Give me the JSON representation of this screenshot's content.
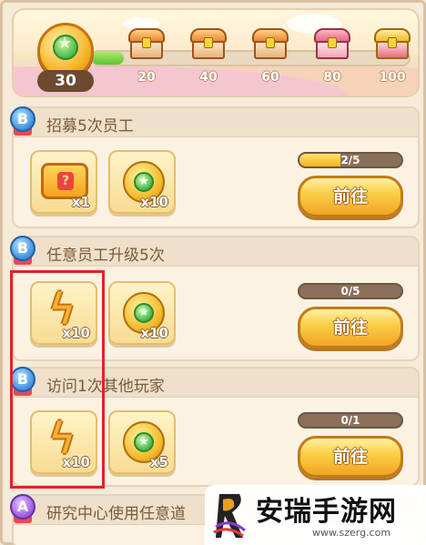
{
  "level": {
    "value": "30"
  },
  "milestones": [
    {
      "label": "20",
      "style": "orange"
    },
    {
      "label": "40",
      "style": "orange"
    },
    {
      "label": "60",
      "style": "orange"
    },
    {
      "label": "80",
      "style": "pink"
    },
    {
      "label": "100",
      "style": "gold"
    }
  ],
  "level_progress_fraction": 0.1,
  "tasks": [
    {
      "grade": "B",
      "title": "招募5次员工",
      "rewards": [
        {
          "icon": "ticket-icon",
          "qty": "x1"
        },
        {
          "icon": "gem-coin-icon",
          "qty": "x10"
        }
      ],
      "progress_text": "2/5",
      "progress_fraction": 0.4,
      "button": "前往"
    },
    {
      "grade": "B",
      "title": "任意员工升级5次",
      "rewards": [
        {
          "icon": "lightning-icon",
          "qty": "x10"
        },
        {
          "icon": "gem-coin-icon",
          "qty": "x10"
        }
      ],
      "progress_text": "0/5",
      "progress_fraction": 0,
      "button": "前往"
    },
    {
      "grade": "B",
      "title": "访问1次其他玩家",
      "rewards": [
        {
          "icon": "lightning-icon",
          "qty": "x10"
        },
        {
          "icon": "gem-coin-icon",
          "qty": "x5"
        }
      ],
      "progress_text": "0/1",
      "progress_fraction": 0,
      "button": "前往"
    },
    {
      "grade": "A",
      "title": "研究中心使用任意道"
    }
  ],
  "watermark": {
    "title": "安瑞手游网",
    "url": "www.szerg.com"
  },
  "colors": {
    "highlight": "#e02424",
    "button": "#f7c23a",
    "progress_fill": "#f4c21a"
  }
}
